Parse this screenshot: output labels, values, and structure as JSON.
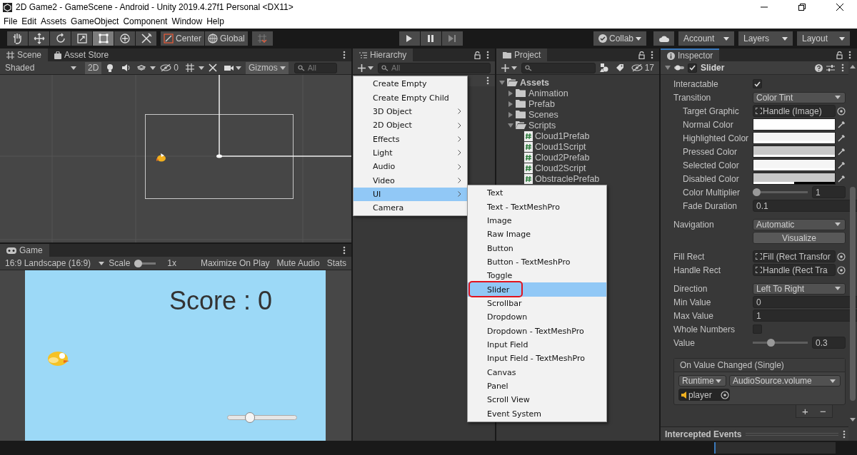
{
  "window": {
    "title": "2D Game2 - GameScene - Android - Unity 2019.4.27f1 Personal <DX11>"
  },
  "menu_bar": [
    "File",
    "Edit",
    "Assets",
    "GameObject",
    "Component",
    "Window",
    "Help"
  ],
  "toolbar": {
    "tools": [
      {
        "kind": "hand",
        "selected": false
      },
      {
        "kind": "move",
        "selected": false
      },
      {
        "kind": "rotate",
        "selected": false
      },
      {
        "kind": "scale",
        "selected": false
      },
      {
        "kind": "rect",
        "selected": true
      },
      {
        "kind": "transform",
        "selected": false
      },
      {
        "kind": "custom",
        "selected": false
      }
    ],
    "pivot": [
      "Center",
      "Global"
    ],
    "play": [
      {
        "kind": "play"
      },
      {
        "kind": "pause"
      },
      {
        "kind": "step"
      }
    ],
    "collab": "Collab",
    "account": "Account",
    "layers": "Layers",
    "layout": "Layout"
  },
  "scene_panel": {
    "tabs": [
      {
        "label": "Scene",
        "selected": true
      },
      {
        "label": "Asset Store",
        "selected": false
      }
    ],
    "shading": "Shaded",
    "mode_2d": {
      "label": "2D",
      "on": true
    },
    "hidden_count": "0",
    "gizmos": "Gizmos",
    "search": {
      "placeholder": "All"
    }
  },
  "game_panel": {
    "tab": "Game",
    "aspect": "16:9 Landscape (16:9)",
    "scale": {
      "label": "Scale",
      "level": 0,
      "reading": "1x"
    },
    "buttons": [
      "Maximize On Play",
      "Mute Audio",
      "Stats"
    ],
    "view": {
      "score": "Score : 0",
      "slider": {
        "level": 0.3
      }
    }
  },
  "hierarchy_panel": {
    "tab": "Hierarchy",
    "search": {
      "placeholder": "All"
    }
  },
  "create_menu": {
    "items": [
      {
        "label": "Create Empty",
        "submenu": false,
        "selected": false
      },
      {
        "label": "Create Empty Child",
        "submenu": false,
        "selected": false
      },
      {
        "label": "3D Object",
        "submenu": true,
        "selected": false
      },
      {
        "label": "2D Object",
        "submenu": true,
        "selected": false
      },
      {
        "label": "Effects",
        "submenu": true,
        "selected": false
      },
      {
        "label": "Light",
        "submenu": true,
        "selected": false
      },
      {
        "label": "Audio",
        "submenu": true,
        "selected": false
      },
      {
        "label": "Video",
        "submenu": true,
        "selected": false
      },
      {
        "label": "UI",
        "submenu": true,
        "selected": true
      },
      {
        "label": "Camera",
        "submenu": false,
        "selected": false
      }
    ]
  },
  "ui_submenu": {
    "items": [
      {
        "label": "Text",
        "selected": false,
        "circled": false
      },
      {
        "label": "Text - TextMeshPro",
        "selected": false,
        "circled": false
      },
      {
        "label": "Image",
        "selected": false,
        "circled": false
      },
      {
        "label": "Raw Image",
        "selected": false,
        "circled": false
      },
      {
        "label": "Button",
        "selected": false,
        "circled": false
      },
      {
        "label": "Button - TextMeshPro",
        "selected": false,
        "circled": false
      },
      {
        "label": "Toggle",
        "selected": false,
        "circled": false
      },
      {
        "label": "Slider",
        "selected": true,
        "circled": true
      },
      {
        "label": "Scrollbar",
        "selected": false,
        "circled": false
      },
      {
        "label": "Dropdown",
        "selected": false,
        "circled": false
      },
      {
        "label": "Dropdown - TextMeshPro",
        "selected": false,
        "circled": false
      },
      {
        "label": "Input Field",
        "selected": false,
        "circled": false
      },
      {
        "label": "Input Field - TextMeshPro",
        "selected": false,
        "circled": false
      },
      {
        "label": "Canvas",
        "selected": false,
        "circled": false
      },
      {
        "label": "Panel",
        "selected": false,
        "circled": false
      },
      {
        "label": "Scroll View",
        "selected": false,
        "circled": false
      },
      {
        "label": "Event System",
        "selected": false,
        "circled": false
      }
    ]
  },
  "project_panel": {
    "tab": "Project",
    "hidden_count": "17",
    "tree": [
      {
        "label": "Assets",
        "kind": "folder",
        "expanded": true,
        "children": [
          {
            "label": "Animation",
            "kind": "folder",
            "expanded": false
          },
          {
            "label": "Prefab",
            "kind": "folder",
            "expanded": false
          },
          {
            "label": "Scenes",
            "kind": "folder",
            "expanded": false
          },
          {
            "label": "Scripts",
            "kind": "folder",
            "expanded": true,
            "children": [
              {
                "label": "Cloud1Prefab",
                "kind": "script"
              },
              {
                "label": "Cloud1Script",
                "kind": "script"
              },
              {
                "label": "Cloud2Prefab",
                "kind": "script"
              },
              {
                "label": "Cloud2Script",
                "kind": "script"
              },
              {
                "label": "ObstraclePrefab",
                "kind": "script"
              }
            ]
          }
        ]
      }
    ]
  },
  "inspector_panel": {
    "tab": "Inspector",
    "component": {
      "title": "Slider",
      "enabled": true,
      "expanded": true
    },
    "sections": [
      [
        {
          "label": "Interactable",
          "kind": "checkbox",
          "checked": true
        },
        {
          "label": "Transition",
          "kind": "dropdown",
          "value": "Color Tint",
          "children": [
            {
              "label": "Target Graphic",
              "kind": "object",
              "value": "Handle (Image)"
            },
            {
              "label": "Normal Color",
              "kind": "color",
              "color": "#ffffff",
              "level": 1
            },
            {
              "label": "Highlighted Color",
              "kind": "color",
              "color": "#f5f5f5",
              "level": 1
            },
            {
              "label": "Pressed Color",
              "kind": "color",
              "color": "#c8c8c8",
              "level": 1
            },
            {
              "label": "Selected Color",
              "kind": "color",
              "color": "#f5f5f5",
              "level": 1
            },
            {
              "label": "Disabled Color",
              "kind": "color",
              "color": "#c8c8c8",
              "level": 0.5
            },
            {
              "label": "Color Multiplier",
              "kind": "slider",
              "level": 0,
              "value": "1"
            },
            {
              "label": "Fade Duration",
              "kind": "number",
              "value": "0.1"
            }
          ]
        }
      ],
      [
        {
          "label": "Navigation",
          "kind": "dropdown",
          "value": "Automatic"
        },
        {
          "label": "Visualize",
          "kind": "button"
        }
      ],
      [
        {
          "label": "Fill Rect",
          "kind": "object",
          "value": "Fill (Rect Transfor"
        },
        {
          "label": "Handle Rect",
          "kind": "object",
          "value": "Handle (Rect Tra"
        }
      ],
      [
        {
          "label": "Direction",
          "kind": "dropdown",
          "value": "Left To Right"
        },
        {
          "label": "Min Value",
          "kind": "number",
          "value": "0"
        },
        {
          "label": "Max Value",
          "kind": "number",
          "value": "1"
        },
        {
          "label": "Whole Numbers",
          "kind": "checkbox",
          "checked": false
        },
        {
          "label": "Value",
          "kind": "slider",
          "level": 0.3,
          "value": "0.3"
        }
      ]
    ],
    "event": {
      "title": "On Value Changed (Single)",
      "runtime": "Runtime",
      "function": "AudioSource.volume",
      "target": "player",
      "add": "+",
      "remove": "−"
    },
    "footer": "Intercepted Events"
  }
}
